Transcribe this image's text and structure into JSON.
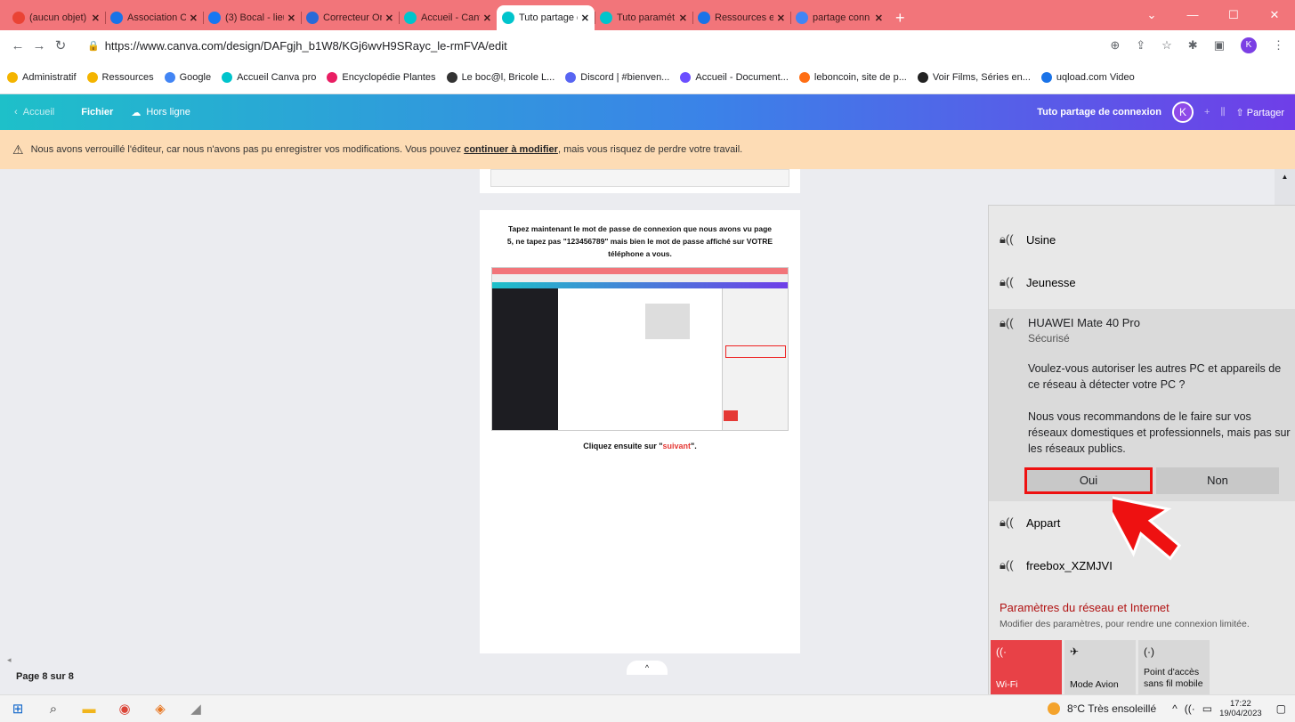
{
  "tabs": [
    {
      "title": "(aucun objet)",
      "color": "#ea4335"
    },
    {
      "title": "Association Cr",
      "color": "#1a73e8"
    },
    {
      "title": "(3) Bocal - lieu",
      "color": "#1877f2"
    },
    {
      "title": "Correcteur Or",
      "color": "#2a6ad8"
    },
    {
      "title": "Accueil - Canv",
      "color": "#00c4cc"
    },
    {
      "title": "Tuto partage c",
      "color": "#00c4cc",
      "active": true
    },
    {
      "title": "Tuto paramét",
      "color": "#00c4cc"
    },
    {
      "title": "Ressources et",
      "color": "#1a73e8"
    },
    {
      "title": "partage conn",
      "color": "#4285f4"
    }
  ],
  "address": {
    "url": "https://www.canva.com/design/DAFgjh_b1W8/KGj6wvH9SRayc_le-rmFVA/edit",
    "avatar": "K"
  },
  "bookmarks": [
    "Administratif",
    "Ressources",
    "Google",
    "Accueil Canva pro",
    "Encyclopédie Plantes",
    "Le boc@l, Bricole L...",
    "Discord | #bienven...",
    "Accueil - Document...",
    "leboncoin, site de p...",
    "Voir Films, Séries en...",
    "uqload.com Video"
  ],
  "editor": {
    "home": "Accueil",
    "file": "Fichier",
    "offline": "Hors ligne",
    "title": "Tuto partage de connexion",
    "avatar": "K",
    "share": "Partager"
  },
  "warning": {
    "pre": "Nous avons verrouillé l'éditeur, car nous n'avons pas pu enregistrer vos modifications. Vous pouvez ",
    "link": "continuer à modifier",
    "post": ", mais vous risquez de perdre votre travail."
  },
  "page": {
    "line1": "Tapez maintenant le mot de passe de connexion que nous avons vu page",
    "line2": "5, ne tapez pas \"123456789\" mais bien le mot de passe affiché sur VOTRE",
    "line3": "téléphone a vous.",
    "cta_pre": "Cliquez ensuite sur \"",
    "cta_word": "suivant",
    "cta_post": "\"."
  },
  "pageindicator": "Page 8 sur 8",
  "network": {
    "items": [
      "Usine",
      "Jeunesse"
    ],
    "selected": {
      "name": "HUAWEI Mate 40 Pro",
      "status": "Sécurisé",
      "question": "Voulez-vous autoriser les autres PC et appareils de ce réseau à détecter votre PC ?",
      "recommend": "Nous vous recommandons de le faire sur vos réseaux domestiques et professionnels, mais pas sur les réseaux publics.",
      "yes": "Oui",
      "no": "Non"
    },
    "after": [
      "Appart",
      "freebox_XZMJVI"
    ],
    "settings": "Paramètres du réseau et Internet",
    "settings_sub": "Modifier des paramètres, pour rendre une connexion limitée.",
    "quick": [
      {
        "label": "Wi-Fi",
        "icon": "wifi-icon",
        "on": true
      },
      {
        "label": "Mode Avion",
        "icon": "airplane-icon",
        "on": false
      },
      {
        "label": "Point d'accès sans fil mobile",
        "icon": "hotspot-icon",
        "on": false
      }
    ]
  },
  "taskbar": {
    "weather": "8°C  Très ensoleillé",
    "time": "17:22",
    "date": "19/04/2023"
  },
  "colors": {
    "accent_red": "#e11111",
    "tabbar": "#f2757a",
    "wifi_on": "#e84147"
  }
}
